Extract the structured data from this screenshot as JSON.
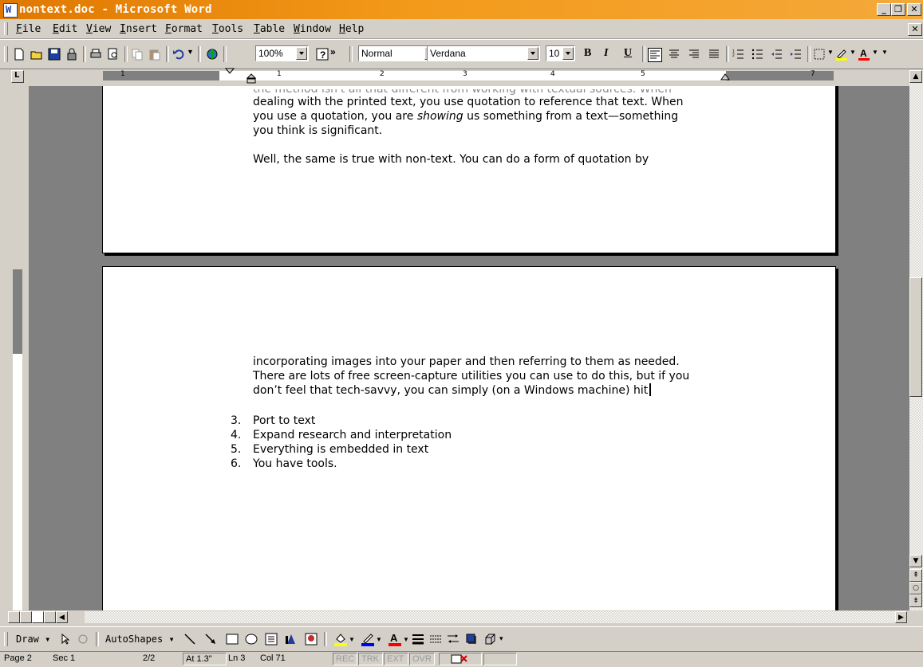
{
  "window": {
    "title": "nontext.doc - Microsoft Word"
  },
  "titlebar_buttons": {
    "minimize": "_",
    "restore": "❐",
    "close": "✕"
  },
  "menu": [
    "File",
    "Edit",
    "View",
    "Insert",
    "Format",
    "Tools",
    "Table",
    "Window",
    "Help"
  ],
  "toolbar": {
    "zoom": "100%",
    "style": "Normal",
    "font": "Verdana",
    "size": "10",
    "bold": "B",
    "italic": "I",
    "underline": "U",
    "more": "»"
  },
  "ruler": {
    "labels": [
      "1",
      "1",
      "2",
      "3",
      "4",
      "5",
      "7"
    ]
  },
  "document": {
    "page1_partial": "the method isn't all that different from working with textual sources. When",
    "page1_lines": [
      "dealing with the printed text, you use quotation to reference that text.  When",
      "you use a quotation, you are ",
      "showing",
      " us something from a text—something",
      "you think is significant.",
      "Well, the same is true with non-text.  You can do a form of quotation by"
    ],
    "page2_lines": [
      "incorporating images into your paper and then referring to them as needed.",
      "There are lots of free screen-capture utilities you can use to do this, but if you",
      "don’t feel that tech-savvy, you can simply (on a Windows machine) hit"
    ],
    "list": [
      {
        "num": "3.",
        "text": "Port to text"
      },
      {
        "num": "4.",
        "text": "Expand research and interpretation"
      },
      {
        "num": "5.",
        "text": "Everything is embedded in text"
      },
      {
        "num": "6.",
        "text": "You have tools."
      }
    ]
  },
  "drawbar": {
    "draw": "Draw",
    "autoshapes": "AutoShapes"
  },
  "status": {
    "page": "Page 2",
    "sec": "Sec 1",
    "pages": "2/2",
    "at": "At 1.3\"",
    "ln": "Ln 3",
    "col": "Col 71",
    "rec": "REC",
    "trk": "TRK",
    "ext": "EXT",
    "ovr": "OVR"
  }
}
